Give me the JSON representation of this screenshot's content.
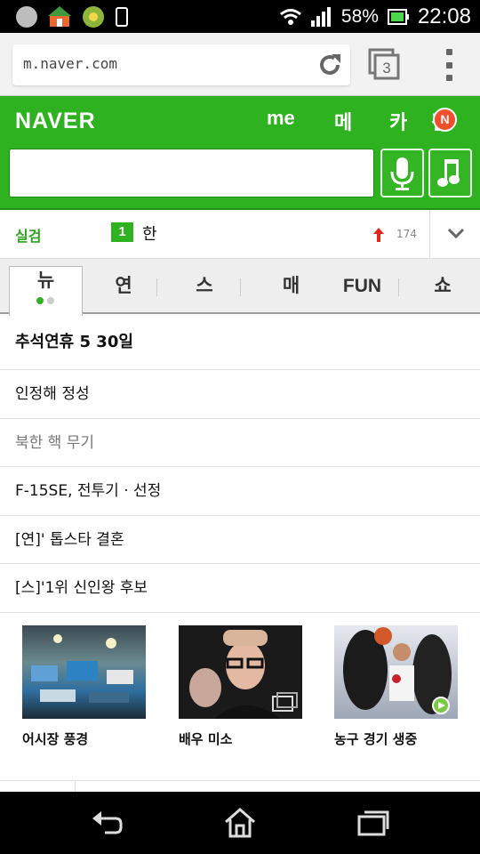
{
  "status_bar": {
    "battery": "58%",
    "time": "22:08",
    "icons": [
      "smiley-icon",
      "home-app-icon",
      "clover-app-icon",
      "phone-icon",
      "wifi-icon",
      "signal-icon",
      "battery-icon"
    ]
  },
  "browser": {
    "url": "m.naver.com",
    "tab_count": "3",
    "icons": [
      "reload-icon",
      "tabs-icon",
      "overflow-menu-icon"
    ]
  },
  "header": {
    "logo": "NAVER",
    "nav": [
      "me",
      "메",
      "카",
      "검"
    ],
    "badge": "N",
    "search_placeholder": "",
    "colors": {
      "brand": "#2fb21f",
      "badge": "#ef4f2a"
    }
  },
  "ranking": {
    "label": "실검",
    "rank": "1",
    "keyword": "한",
    "count": "174"
  },
  "tabs": [
    {
      "label": "뉴",
      "active": true
    },
    {
      "label": "연"
    },
    {
      "label": "스"
    },
    {
      "label": "매"
    },
    {
      "label": "FUN"
    },
    {
      "label": "쇼"
    }
  ],
  "news": [
    "추석연휴 5 30일",
    "인정해 정성",
    "북한 핵 무기",
    "F-15SE, 전투기 · 선정",
    "[연]' 톱스타 결혼",
    "[스]'1위 신인왕 후보"
  ],
  "photos": [
    {
      "caption": "어시장 풍경",
      "icon": "market-photo"
    },
    {
      "caption": "배우 미소",
      "icon": "portrait-photo"
    },
    {
      "caption": "농구 경기 생중",
      "icon": "basketball-photo"
    }
  ],
  "navbar": {
    "icons": [
      "back-icon",
      "home-icon",
      "recents-icon"
    ]
  }
}
